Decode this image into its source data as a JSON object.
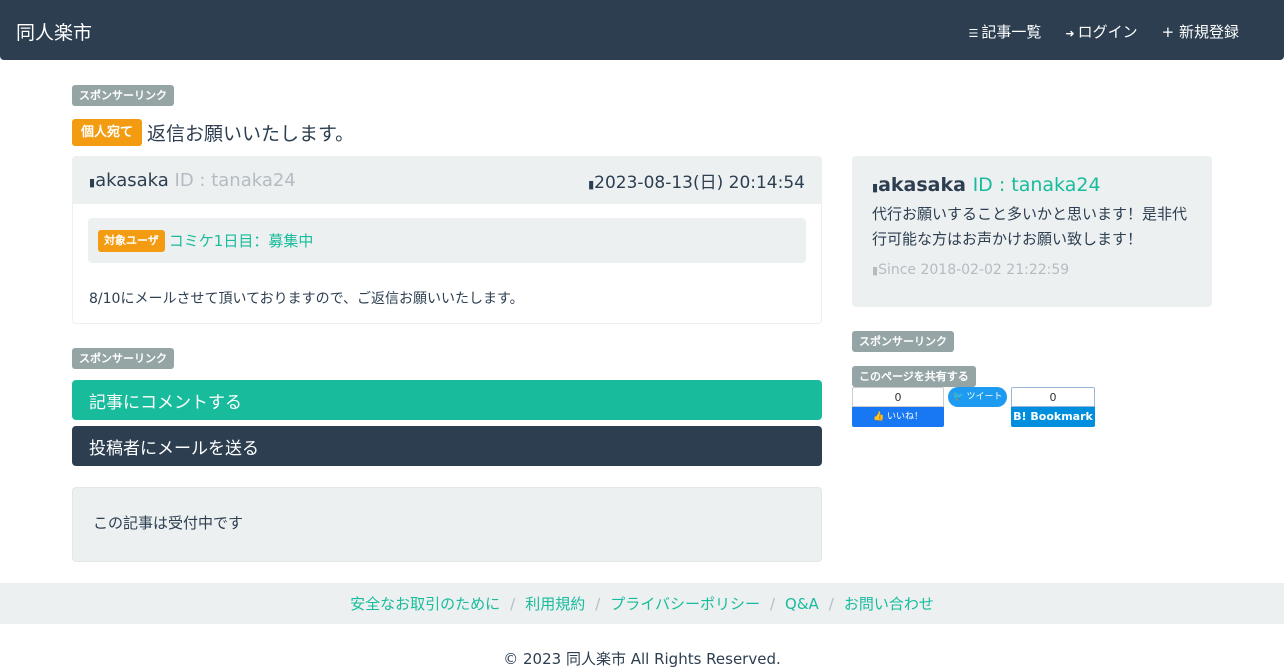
{
  "header": {
    "brand": "同人楽市",
    "nav": [
      {
        "icon": "list-icon",
        "label": "記事一覧"
      },
      {
        "icon": "login-icon",
        "label": "ログイン"
      },
      {
        "icon": "plus-icon",
        "label": "新規登録"
      }
    ]
  },
  "sponsor_label": "スポンサーリンク",
  "article": {
    "badge": "個人宛て",
    "title": "返信お願いいたします。",
    "author": "akasaka",
    "author_id": "ID : tanaka24",
    "date": "2023-08-13(日) 20:14:54",
    "target_badge": "対象ユーザ",
    "target_link": "コミケ1日目：募集中",
    "body": "8/10にメールさせて頂いておりますので、ご返信お願いいたします。"
  },
  "actions": {
    "comment": "記事にコメントする",
    "mail": "投稿者にメールを送る"
  },
  "status_text": "この記事は受付中です",
  "profile": {
    "name": "akasaka",
    "id": "ID : tanaka24",
    "bio": "代行お願いすること多いかと思います！是非代行可能な方はお声かけお願い致します！",
    "since": "Since 2018-02-02 21:22:59"
  },
  "share": {
    "label": "このページを共有する",
    "fb_count": "0",
    "fb_label": "いいね！",
    "tw_label": "ツイート",
    "hb_count": "0",
    "hb_label": "Bookmark"
  },
  "footer": {
    "links": [
      "安全なお取引のために",
      "利用規約",
      "プライバシーポリシー",
      "Q&A",
      "お問い合わせ"
    ],
    "separator": "/",
    "copyright": "© 2023 同人楽市 All Rights Reserved."
  },
  "colors": {
    "navy": "#2c3e50",
    "teal": "#18bc9c",
    "orange": "#f39c12",
    "gray": "#95a5a6",
    "light": "#ecf0f1"
  }
}
